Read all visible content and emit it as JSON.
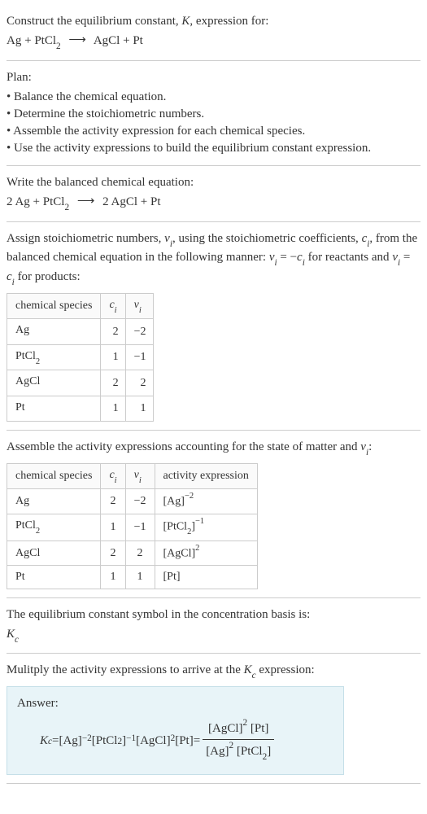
{
  "intro": {
    "line1_pre": "Construct the equilibrium constant, ",
    "line1_K": "K",
    "line1_post": ", expression for:",
    "eq_lhs1": "Ag",
    "eq_plus": " + ",
    "eq_lhs2a": "PtCl",
    "eq_lhs2b": "2",
    "eq_arrow": "⟶",
    "eq_rhs1": "AgCl",
    "eq_rhs2": "Pt"
  },
  "plan": {
    "header": "Plan:",
    "items": [
      "• Balance the chemical equation.",
      "• Determine the stoichiometric numbers.",
      "• Assemble the activity expression for each chemical species.",
      "• Use the activity expressions to build the equilibrium constant expression."
    ]
  },
  "balanced": {
    "header": "Write the balanced chemical equation:",
    "c1": "2",
    "s1": "Ag",
    "plus": " + ",
    "s2a": "PtCl",
    "s2b": "2",
    "arrow": "⟶",
    "c3": "2",
    "s3": "AgCl",
    "s4": "Pt"
  },
  "stoich": {
    "text1": "Assign stoichiometric numbers, ",
    "nu": "ν",
    "i": "i",
    "text2": ", using the stoichiometric coefficients, ",
    "c": "c",
    "text3": ", from the balanced chemical equation in the following manner: ",
    "eq1a": "ν",
    "eq1b": " = −",
    "eq1c": "c",
    "text4": " for reactants and ",
    "eq2a": "ν",
    "eq2b": " = ",
    "eq2c": "c",
    "text5": " for products:",
    "h1": "chemical species",
    "h2a": "c",
    "h2b": "i",
    "h3a": "ν",
    "h3b": "i",
    "rows": [
      {
        "sp": "Ag",
        "sp_sub": "",
        "c": "2",
        "nu": "−2"
      },
      {
        "sp": "PtCl",
        "sp_sub": "2",
        "c": "1",
        "nu": "−1"
      },
      {
        "sp": "AgCl",
        "sp_sub": "",
        "c": "2",
        "nu": "2"
      },
      {
        "sp": "Pt",
        "sp_sub": "",
        "c": "1",
        "nu": "1"
      }
    ]
  },
  "activity": {
    "text1": "Assemble the activity expressions accounting for the state of matter and ",
    "nu": "ν",
    "i": "i",
    "text2": ":",
    "h1": "chemical species",
    "h2a": "c",
    "h2b": "i",
    "h3a": "ν",
    "h3b": "i",
    "h4": "activity expression",
    "rows": [
      {
        "sp": "Ag",
        "sp_sub": "",
        "c": "2",
        "nu": "−2",
        "act_base": "[Ag]",
        "act_exp": "−2"
      },
      {
        "sp": "PtCl",
        "sp_sub": "2",
        "c": "1",
        "nu": "−1",
        "act_base": "[PtCl",
        "act_sub": "2",
        "act_close": "]",
        "act_exp": "−1"
      },
      {
        "sp": "AgCl",
        "sp_sub": "",
        "c": "2",
        "nu": "2",
        "act_base": "[AgCl]",
        "act_exp": "2"
      },
      {
        "sp": "Pt",
        "sp_sub": "",
        "c": "1",
        "nu": "1",
        "act_base": "[Pt]",
        "act_exp": ""
      }
    ]
  },
  "symbol": {
    "text": "The equilibrium constant symbol in the concentration basis is:",
    "Kc_K": "K",
    "Kc_c": "c"
  },
  "final": {
    "text": "Mulitply the activity expressions to arrive at the ",
    "Kc_K": "K",
    "Kc_c": "c",
    "text2": " expression:",
    "answer_label": "Answer:",
    "lhs_K": "K",
    "lhs_c": "c",
    "eq": " = ",
    "t1": "[Ag]",
    "e1": "−2",
    "sp1": " ",
    "t2a": "[PtCl",
    "t2sub": "2",
    "t2b": "]",
    "e2": "−1",
    "sp2": " ",
    "t3": "[AgCl]",
    "e3": "2",
    "sp3": " ",
    "t4": "[Pt]",
    "eq2": " = ",
    "num_t1": "[AgCl]",
    "num_e1": "2",
    "num_sp": " ",
    "num_t2": "[Pt]",
    "den_t1": "[Ag]",
    "den_e1": "2",
    "den_sp": " ",
    "den_t2a": "[PtCl",
    "den_t2sub": "2",
    "den_t2b": "]"
  }
}
